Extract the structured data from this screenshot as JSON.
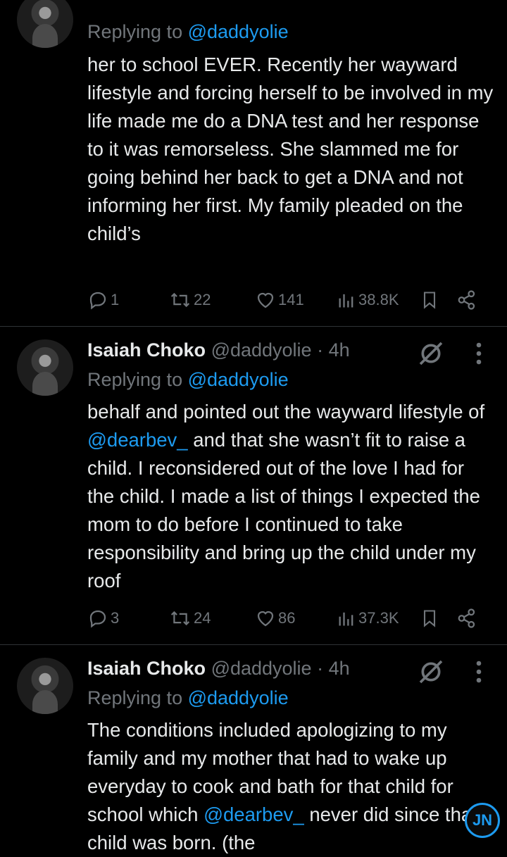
{
  "tweets": [
    {
      "name": "",
      "handle": "",
      "time": "",
      "replying_prefix": "Replying to ",
      "replying_handle": "@daddyolie",
      "body_parts": [
        {
          "text": "her to school EVER. Recently her wayward lifestyle and forcing herself to be involved in my life made me do a DNA test and her response to it was remorseless. She slammed me for going behind her back to get a DNA and not informing her first. My family pleaded on the child’s",
          "link": false
        }
      ],
      "replies": "1",
      "reposts": "22",
      "likes": "141",
      "views": "38.8K"
    },
    {
      "name": "Isaiah Choko",
      "handle": "@daddyolie",
      "time": " · 4h",
      "replying_prefix": "Replying to ",
      "replying_handle": "@daddyolie",
      "body_parts": [
        {
          "text": "behalf and pointed out the wayward lifestyle of ",
          "link": false
        },
        {
          "text": "@dearbev_",
          "link": true
        },
        {
          "text": " and that she wasn’t fit to raise a child. I reconsidered out of the love I had for the child. I made a list of things I expected the mom to do before I continued to take responsibility and bring up the child under my roof",
          "link": false
        }
      ],
      "replies": "3",
      "reposts": "24",
      "likes": "86",
      "views": "37.3K"
    },
    {
      "name": "Isaiah Choko",
      "handle": "@daddyolie",
      "time": " · 4h",
      "replying_prefix": "Replying to ",
      "replying_handle": "@daddyolie",
      "body_parts": [
        {
          "text": "The conditions included apologizing to my family and my mother that had to wake up everyday to cook and bath for that child for school which ",
          "link": false
        },
        {
          "text": "@dearbev_",
          "link": true
        },
        {
          "text": " never did since that child was born. (the",
          "link": false
        }
      ]
    }
  ],
  "watermark": "JN",
  "colors": {
    "background": "#000000",
    "text": "#e7e9ea",
    "muted": "#71767b",
    "link": "#1d9bf0"
  }
}
